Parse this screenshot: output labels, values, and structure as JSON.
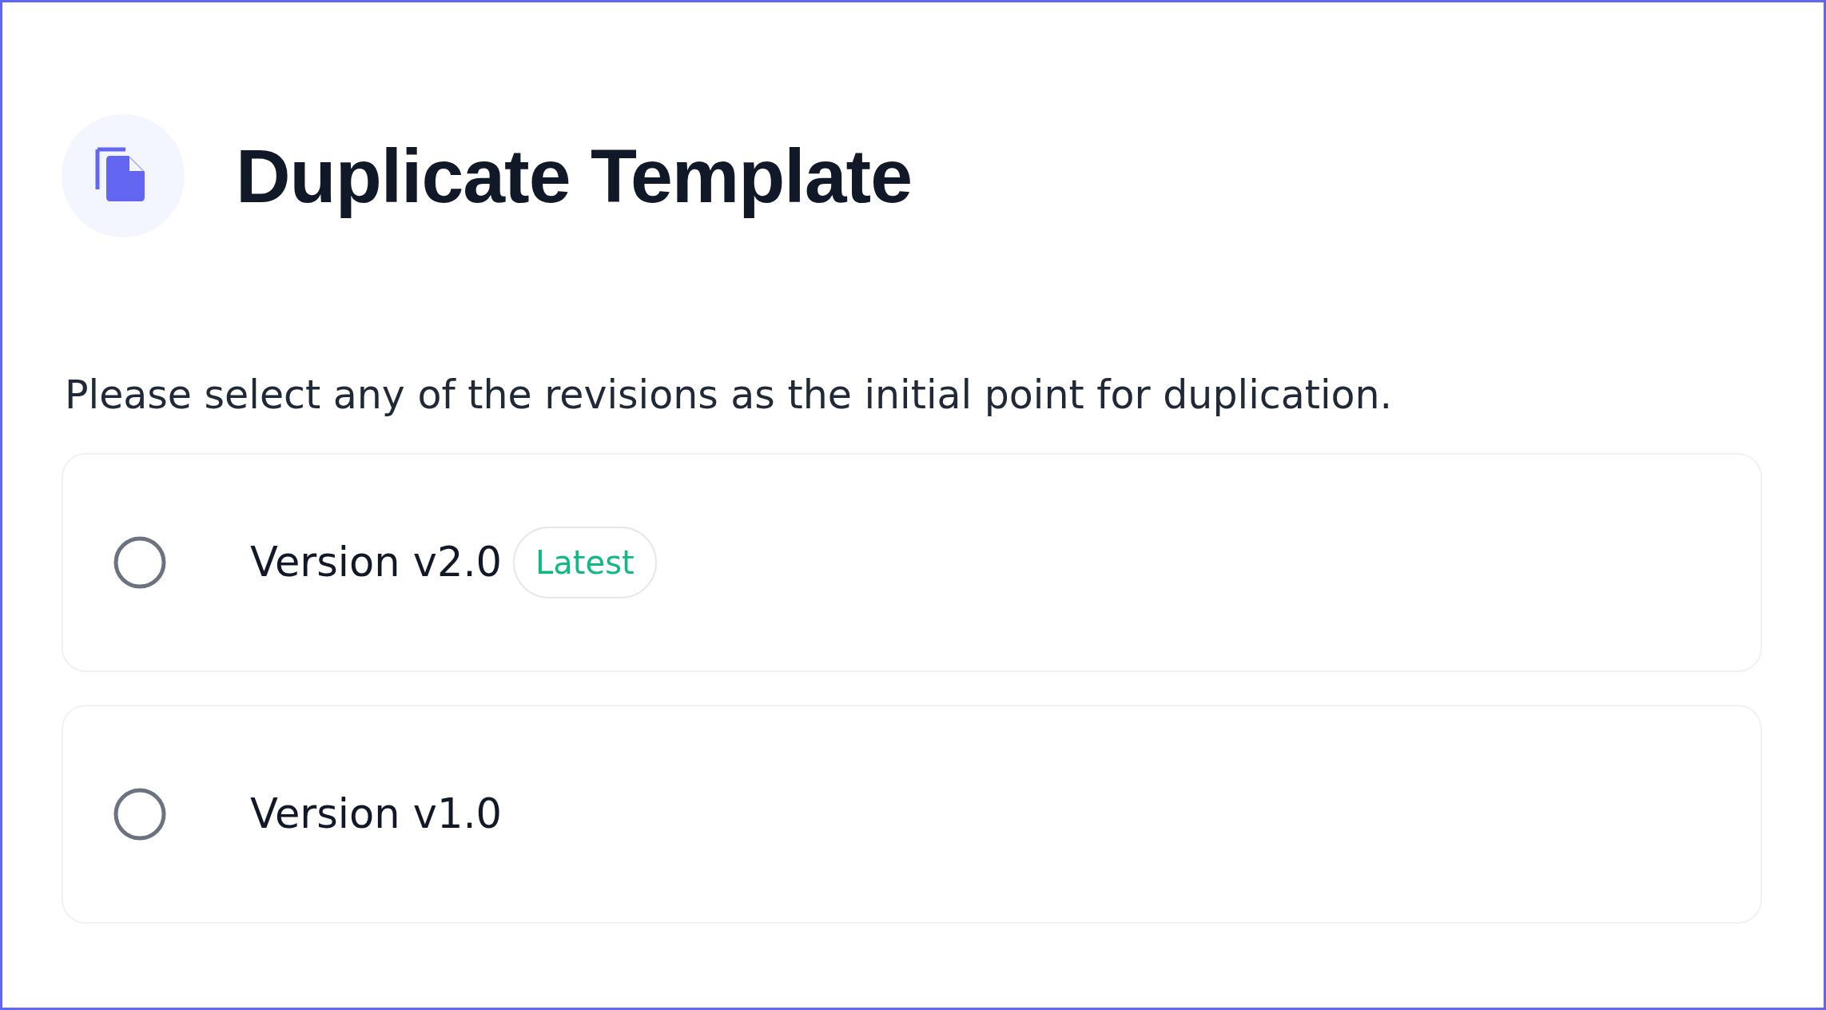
{
  "dialog": {
    "title": "Duplicate Template",
    "description": "Please select any of the revisions as the initial point for duplication."
  },
  "revisions": [
    {
      "label": "Version v2.0",
      "badge": "Latest",
      "selected": false
    },
    {
      "label": "Version v1.0",
      "selected": false
    }
  ]
}
